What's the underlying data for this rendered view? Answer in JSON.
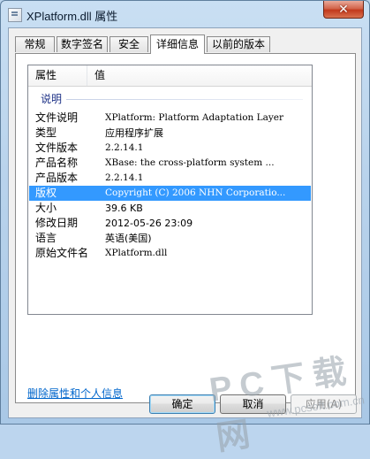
{
  "window": {
    "title": "XPlatform.dll 属性",
    "close_glyph": "✕"
  },
  "tabs": [
    {
      "label": "常规"
    },
    {
      "label": "数字签名"
    },
    {
      "label": "安全"
    },
    {
      "label": "详细信息"
    },
    {
      "label": "以前的版本"
    }
  ],
  "details": {
    "columns": {
      "property": "属性",
      "value": "值"
    },
    "group_label": "说明",
    "rows": [
      {
        "key": "文件说明",
        "value": "XPlatform: Platform Adaptation Layer"
      },
      {
        "key": "类型",
        "value": "应用程序扩展"
      },
      {
        "key": "文件版本",
        "value": "2.2.14.1"
      },
      {
        "key": "产品名称",
        "value": "XBase: the cross-platform system ..."
      },
      {
        "key": "产品版本",
        "value": "2.2.14.1"
      },
      {
        "key": "版权",
        "value": "Copyright (C) 2006 NHN Corporatio...",
        "selected": true
      },
      {
        "key": "大小",
        "value": "39.6 KB"
      },
      {
        "key": "修改日期",
        "value": "2012-05-26 23:09"
      },
      {
        "key": "语言",
        "value": "英语(美国)"
      },
      {
        "key": "原始文件名",
        "value": "XPlatform.dll"
      }
    ]
  },
  "remove_link": "删除属性和个人信息",
  "buttons": {
    "ok": "确定",
    "cancel": "取消",
    "apply": "应用(A)"
  },
  "watermark": {
    "text": "PC下载网",
    "sub": "www.pcsoft.com.cn"
  },
  "colors": {
    "selection": "#3399ff",
    "link": "#0066cc",
    "group": "#1e3287"
  }
}
